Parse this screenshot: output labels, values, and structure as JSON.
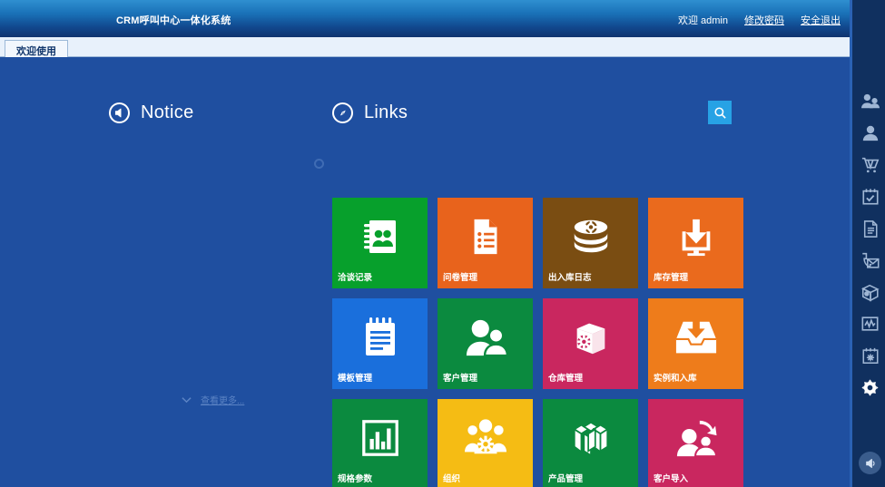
{
  "header": {
    "title": "CRM呼叫中心一体化系统",
    "welcome": "欢迎 admin",
    "change_password": "修改密码",
    "logout": "安全退出",
    "bg_top": "#2f8fd0",
    "bg_bottom": "#10336f"
  },
  "tabs": [
    {
      "label": "欢迎使用",
      "active": true
    }
  ],
  "notice": {
    "title": "Notice",
    "icon": "speaker-icon",
    "more_label": "查看更多...",
    "more_icon": "chevron-down-icon",
    "items": []
  },
  "links": {
    "title": "Links",
    "icon": "compass-icon",
    "search_icon": "search-icon",
    "search_color": "#27a2e5",
    "tiles": [
      {
        "label": "洽谈记录",
        "color": "#07a02c",
        "icon": "address-book-icon"
      },
      {
        "label": "问卷管理",
        "color": "#e8631c",
        "icon": "survey-doc-icon"
      },
      {
        "label": "出入库日志",
        "color": "#7a4d12",
        "icon": "database-gear-icon"
      },
      {
        "label": "库存管理",
        "color": "#ea6a1d",
        "icon": "download-monitor-icon"
      },
      {
        "label": "模板管理",
        "color": "#1a6fdc",
        "icon": "notepad-icon"
      },
      {
        "label": "客户管理",
        "color": "#0b8a3f",
        "icon": "two-people-icon"
      },
      {
        "label": "仓库管理",
        "color": "#c9275f",
        "icon": "box-gear-icon"
      },
      {
        "label": "实例和入库",
        "color": "#ee7c1b",
        "icon": "inbox-download-icon"
      },
      {
        "label": "规格参数",
        "color": "#0b8a3f",
        "icon": "bar-chart-icon"
      },
      {
        "label": "组织",
        "color": "#f5bc14",
        "icon": "group-gear-icon"
      },
      {
        "label": "产品管理",
        "color": "#0b8a3f",
        "icon": "product-blocks-icon"
      },
      {
        "label": "客户导入",
        "color": "#c9275f",
        "icon": "person-import-icon"
      }
    ]
  },
  "rail": {
    "background": "#10305f",
    "accent": "#2a62b4",
    "icons": [
      {
        "name": "two-people-icon"
      },
      {
        "name": "single-person-icon"
      },
      {
        "name": "shopping-cart-icon"
      },
      {
        "name": "calendar-check-icon"
      },
      {
        "name": "document-list-icon"
      },
      {
        "name": "phone-mail-icon"
      },
      {
        "name": "box-gear-icon"
      },
      {
        "name": "monitor-chart-icon"
      },
      {
        "name": "calendar-gear-icon"
      },
      {
        "name": "settings-gear-icon"
      }
    ],
    "sound_icon": "volume-icon"
  }
}
